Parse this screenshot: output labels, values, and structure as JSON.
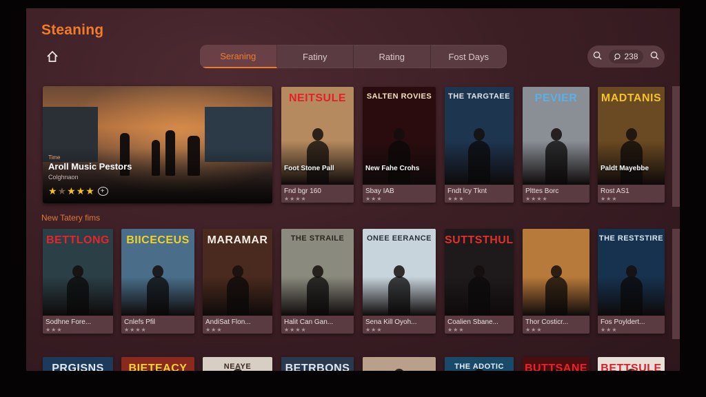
{
  "app": {
    "title": "Steaning"
  },
  "tabs": [
    "Seraning",
    "Fatiny",
    "Rating",
    "Fost Days"
  ],
  "search": {
    "value": "238"
  },
  "hero": {
    "badge": "Time",
    "title": "Aroll Music Pestors",
    "subtitle": "Colghnaon",
    "rating": 4.5
  },
  "row1": [
    {
      "poster_title": "NEITSULE",
      "overlay": "Foot Stone Pall",
      "label": "Fnd bgr 160",
      "stars": "★★★★",
      "bg": "#b58a5e",
      "fg": "#e3202a"
    },
    {
      "poster_title": "SALTEN ROVIES",
      "overlay": "New Fahe Crohs",
      "label": "Sbay IAB",
      "stars": "★★★",
      "bg": "#2a0c0e",
      "fg": "#f1e2c0"
    },
    {
      "poster_title": "THE TARGTAEE",
      "overlay": "",
      "label": "Fndt lcy Tknt",
      "stars": "★★★",
      "bg": "#1e3550",
      "fg": "#dfe6ee"
    },
    {
      "poster_title": "PEVIER",
      "overlay": "",
      "label": "Plttes Borc",
      "stars": "★★★★",
      "bg": "#8a8f96",
      "fg": "#5ab0e6"
    },
    {
      "poster_title": "MADTANIS",
      "overlay": "Paldt Mayebbe",
      "label": "Rost AS1",
      "stars": "★★★",
      "bg": "#6a4a22",
      "fg": "#f2c230"
    }
  ],
  "section2_title": "New Tatery fims",
  "row2": [
    {
      "poster_title": "BETTLONG",
      "label": "Sodhne Fore...",
      "stars": "★★★",
      "bg": "#2a4046",
      "fg": "#e8242a"
    },
    {
      "poster_title": "BIICECEUS",
      "label": "Cnlefs Pfil",
      "stars": "★★★★",
      "bg": "#4a6e8a",
      "fg": "#f1d12a"
    },
    {
      "poster_title": "MARAMAR",
      "label": "AndiSat Flon...",
      "stars": "★★★",
      "bg": "#4a2a1e",
      "fg": "#f4efe6"
    },
    {
      "poster_title": "THE STRAILE",
      "label": "Halit Can Gan...",
      "stars": "★★★★",
      "bg": "#8a8a7e",
      "fg": "#2a2420"
    },
    {
      "poster_title": "ONEE EERANCE",
      "label": "Sena Kill Oyoh...",
      "stars": "★★★",
      "bg": "#c8d4dc",
      "fg": "#2a3038"
    },
    {
      "poster_title": "SUTTSTHULL",
      "label": "Coalien Sbane...",
      "stars": "★★★",
      "bg": "#1e1a1c",
      "fg": "#e4302a"
    },
    {
      "poster_title": "",
      "label": "Thor Costicr...",
      "stars": "★★★",
      "bg": "#b87a3a",
      "fg": "#ffffff"
    },
    {
      "poster_title": "THE RESTSTIRE",
      "label": "Fos Poyldert...",
      "stars": "★★★",
      "bg": "#16324e",
      "fg": "#d8e6f0"
    }
  ],
  "row3": [
    {
      "poster_title": "PRGISNS",
      "bg": "#1e3a5a",
      "fg": "#dfe8ef"
    },
    {
      "poster_title": "BIETEACY",
      "bg": "#8a2a1e",
      "fg": "#f4d23a"
    },
    {
      "poster_title": "NEAYE CACOALRE",
      "bg": "#d8cfc4",
      "fg": "#3a2a22"
    },
    {
      "poster_title": "BETRBONS",
      "bg": "#2a3a4e",
      "fg": "#dfe6ee"
    },
    {
      "poster_title": "",
      "bg": "#b8a08a",
      "fg": "#ffffff"
    },
    {
      "poster_title": "THE ADOTIC OCOUT",
      "bg": "#1a4a6a",
      "fg": "#e6eef4"
    },
    {
      "poster_title": "BUTTSANE",
      "bg": "#4a0e10",
      "fg": "#e8242a"
    },
    {
      "poster_title": "BETTSULE",
      "bg": "#e8e0d8",
      "fg": "#d8202a"
    }
  ]
}
